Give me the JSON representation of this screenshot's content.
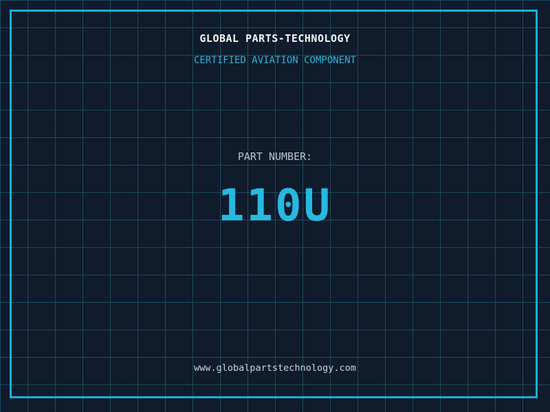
{
  "header": {
    "company": "GLOBAL PARTS-TECHNOLOGY",
    "tagline": "CERTIFIED AVIATION COMPONENT"
  },
  "part": {
    "label": "PART NUMBER:",
    "number": "110U"
  },
  "footer": {
    "website": "www.globalpartstechnology.com"
  },
  "colors": {
    "background": "#101b2b",
    "grid-line": "#1d4a5f",
    "accent": "#12b4d8",
    "part-number": "#26b9e0",
    "title-text": "#f5f7f8",
    "subtitle-text": "#2fb3d6",
    "label-text": "#bac3cf",
    "footer-text": "#ccd5dd"
  }
}
